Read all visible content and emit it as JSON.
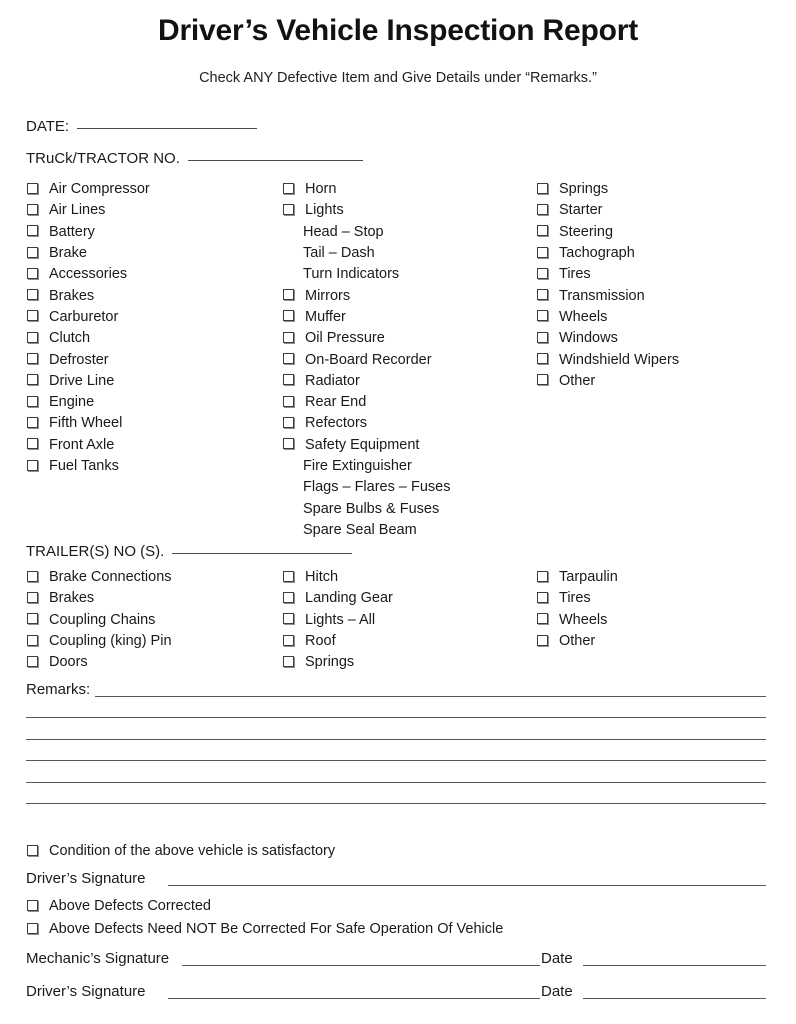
{
  "document": {
    "title": "Driver’s Vehicle Inspection Report",
    "subtitle": "Check ANY Defective Item and Give Details under “Remarks.”"
  },
  "header_fields": [
    {
      "label": "DATE:",
      "value": ""
    },
    {
      "label": "TRuCk/TRACTOR  NO.",
      "value": ""
    }
  ],
  "vehicle_section": {
    "columns": [
      {
        "name": "column-1",
        "items": [
          {
            "label": "Air Compressor",
            "checkbox": true,
            "checked": false
          },
          {
            "label": "Air Lines",
            "checkbox": true,
            "checked": false
          },
          {
            "label": "Battery",
            "checkbox": true,
            "checked": false
          },
          {
            "label": "Brake",
            "checkbox": true,
            "checked": false
          },
          {
            "label": "Accessories",
            "checkbox": true,
            "checked": false
          },
          {
            "label": "Brakes",
            "checkbox": true,
            "checked": false
          },
          {
            "label": "Carburetor",
            "checkbox": true,
            "checked": false
          },
          {
            "label": "Clutch",
            "checkbox": true,
            "checked": false
          },
          {
            "label": "Defroster",
            "checkbox": true,
            "checked": false
          },
          {
            "label": "Drive Line",
            "checkbox": true,
            "checked": false
          },
          {
            "label": "Engine",
            "checkbox": true,
            "checked": false
          },
          {
            "label": "Fifth Wheel",
            "checkbox": true,
            "checked": false
          },
          {
            "label": "Front Axle",
            "checkbox": true,
            "checked": false
          },
          {
            "label": "Fuel Tanks",
            "checkbox": true,
            "checked": false
          }
        ]
      },
      {
        "name": "column-2",
        "items": [
          {
            "label": "Horn",
            "checkbox": true,
            "checked": false
          },
          {
            "label": "Lights",
            "checkbox": true,
            "checked": false
          },
          {
            "label": "Head – Stop",
            "checkbox": false,
            "checked": false
          },
          {
            "label": "Tail – Dash",
            "checkbox": false,
            "checked": false
          },
          {
            "label": "Turn Indicators",
            "checkbox": false,
            "checked": false
          },
          {
            "label": "Mirrors",
            "checkbox": true,
            "checked": false
          },
          {
            "label": "Muffer",
            "checkbox": true,
            "checked": false
          },
          {
            "label": "Oil Pressure",
            "checkbox": true,
            "checked": false
          },
          {
            "label": "On-Board Recorder",
            "checkbox": true,
            "checked": false
          },
          {
            "label": "Radiator",
            "checkbox": true,
            "checked": false
          },
          {
            "label": "Rear End",
            "checkbox": true,
            "checked": false
          },
          {
            "label": "Refectors",
            "checkbox": true,
            "checked": false
          },
          {
            "label": "Safety Equipment",
            "checkbox": true,
            "checked": false
          },
          {
            "label": "Fire Extinguisher",
            "checkbox": false,
            "checked": false
          },
          {
            "label": "Flags – Flares – Fuses",
            "checkbox": false,
            "checked": false
          },
          {
            "label": "Spare Bulbs & Fuses",
            "checkbox": false,
            "checked": false
          },
          {
            "label": "Spare Seal Beam",
            "checkbox": false,
            "checked": false
          }
        ]
      },
      {
        "name": "column-3",
        "items": [
          {
            "label": "Springs",
            "checkbox": true,
            "checked": false
          },
          {
            "label": "Starter",
            "checkbox": true,
            "checked": false
          },
          {
            "label": "Steering",
            "checkbox": true,
            "checked": false
          },
          {
            "label": "Tachograph",
            "checkbox": true,
            "checked": false
          },
          {
            "label": "Tires",
            "checkbox": true,
            "checked": false
          },
          {
            "label": "Transmission",
            "checkbox": true,
            "checked": false
          },
          {
            "label": "Wheels",
            "checkbox": true,
            "checked": false
          },
          {
            "label": "Windows",
            "checkbox": true,
            "checked": false
          },
          {
            "label": "Windshield Wipers",
            "checkbox": true,
            "checked": false
          },
          {
            "label": "Other",
            "checkbox": true,
            "checked": false
          }
        ]
      }
    ]
  },
  "trailer_section": {
    "field": {
      "label": "TRAILER(S) NO (S).",
      "value": ""
    },
    "columns": [
      {
        "name": "trailer-column-1",
        "items": [
          {
            "label": "Brake Connections",
            "checkbox": true,
            "checked": false
          },
          {
            "label": "Brakes",
            "checkbox": true,
            "checked": false
          },
          {
            "label": "Coupling Chains",
            "checkbox": true,
            "checked": false
          },
          {
            "label": "Coupling (king)  Pin",
            "checkbox": true,
            "checked": false
          },
          {
            "label": "Doors",
            "checkbox": true,
            "checked": false
          }
        ]
      },
      {
        "name": "trailer-column-2",
        "items": [
          {
            "label": "Hitch",
            "checkbox": true,
            "checked": false
          },
          {
            "label": "Landing Gear",
            "checkbox": true,
            "checked": false
          },
          {
            "label": "Lights – All",
            "checkbox": true,
            "checked": false
          },
          {
            "label": "Roof",
            "checkbox": true,
            "checked": false
          },
          {
            "label": "Springs",
            "checkbox": true,
            "checked": false
          }
        ]
      },
      {
        "name": "trailer-column-3",
        "items": [
          {
            "label": "Tarpaulin",
            "checkbox": true,
            "checked": false
          },
          {
            "label": "Tires",
            "checkbox": true,
            "checked": false
          },
          {
            "label": "Wheels",
            "checkbox": true,
            "checked": false
          },
          {
            "label": "Other",
            "checkbox": true,
            "checked": false
          }
        ]
      }
    ]
  },
  "remarks": {
    "label": "Remarks:",
    "line_count": 6,
    "value": ""
  },
  "certification": {
    "condition_statement": "Condition of the above vehicle is satisfactory",
    "driver_signature_label": "Driver’s Signature",
    "defects_corrected": "Above Defects Corrected",
    "defects_not_needed": "Above Defects Need NOT Be Corrected For Safe Operation Of Vehicle",
    "mechanic_signature_label": "Mechanic’s Signature",
    "driver_signature_label_2": "Driver’s Signature",
    "date_label_1": "Date",
    "date_label_2": "Date"
  }
}
